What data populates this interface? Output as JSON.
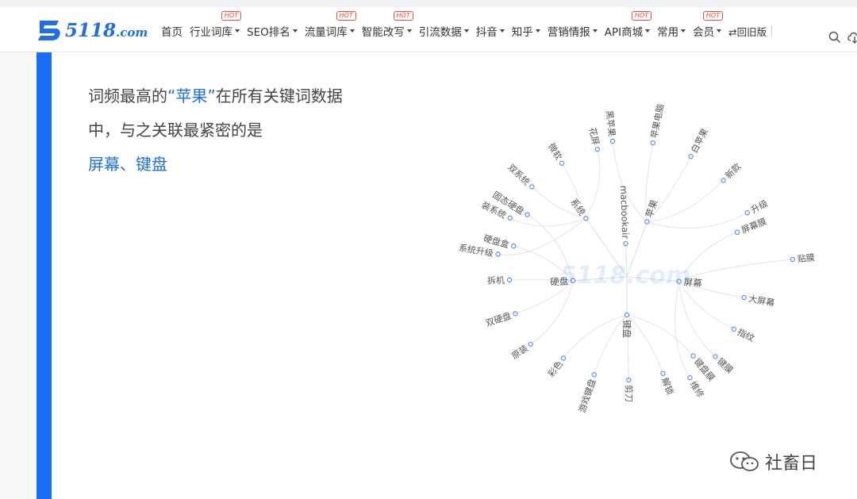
{
  "header": {
    "logo": {
      "name": "5118",
      "suffix": ".com"
    },
    "nav": [
      {
        "label": "首页",
        "caret": false,
        "hot": false
      },
      {
        "label": "行业词库",
        "caret": true,
        "hot": true
      },
      {
        "label": "SEO排名",
        "caret": true,
        "hot": false
      },
      {
        "label": "流量词库",
        "caret": true,
        "hot": true
      },
      {
        "label": "智能改写",
        "caret": true,
        "hot": true
      },
      {
        "label": "引流数据",
        "caret": true,
        "hot": false
      },
      {
        "label": "抖音",
        "caret": true,
        "hot": false
      },
      {
        "label": "知乎",
        "caret": true,
        "hot": false
      },
      {
        "label": "营销情报",
        "caret": true,
        "hot": false
      },
      {
        "label": "API商城",
        "caret": true,
        "hot": true
      },
      {
        "label": "常用",
        "caret": true,
        "hot": false
      },
      {
        "label": "会员",
        "caret": true,
        "hot": true
      }
    ],
    "hot_label": "HOT",
    "old_version": "⇄回旧版",
    "icons": {
      "search": "search-icon",
      "cloud": "cloud-icon"
    }
  },
  "insight": {
    "line1_prefix": "词频最高的",
    "keyword": "“苹果”",
    "line1_suffix": "在所有关键词数据中，与之关联最紧密的是",
    "result": "屏幕、键盘"
  },
  "radial": {
    "center": "苹果",
    "branches": [
      {
        "label": "系统",
        "children": [
          "系统升级",
          "装系统",
          "双系统",
          "微软",
          "花屏"
        ]
      },
      {
        "label": "苹果",
        "children": [
          "黑苹果",
          "苹果电脑",
          "白苹果",
          "新款",
          "升级"
        ]
      },
      {
        "label": "macbookair",
        "children": []
      },
      {
        "label": "屏幕",
        "children": [
          "屏幕膜",
          "贴膜",
          "大屏幕",
          "指纹",
          "键膜",
          "维修"
        ]
      },
      {
        "label": "键盘",
        "children": [
          "键盘膜",
          "解锁",
          "剪刀",
          "游戏键盘",
          "彩色"
        ]
      },
      {
        "label": "硬盘",
        "children": [
          "原装",
          "双硬盘",
          "拆机",
          "硬盘盒",
          "固态硬盘"
        ]
      }
    ],
    "watermark": "5118.com"
  },
  "watermark": {
    "text": "社畜日",
    "icon": "wechat-icon"
  },
  "colors": {
    "accent": "#1a6ef5",
    "brand": "#1e6fe0",
    "hot": "#ef4b3a",
    "node": "#5b8ff9"
  }
}
